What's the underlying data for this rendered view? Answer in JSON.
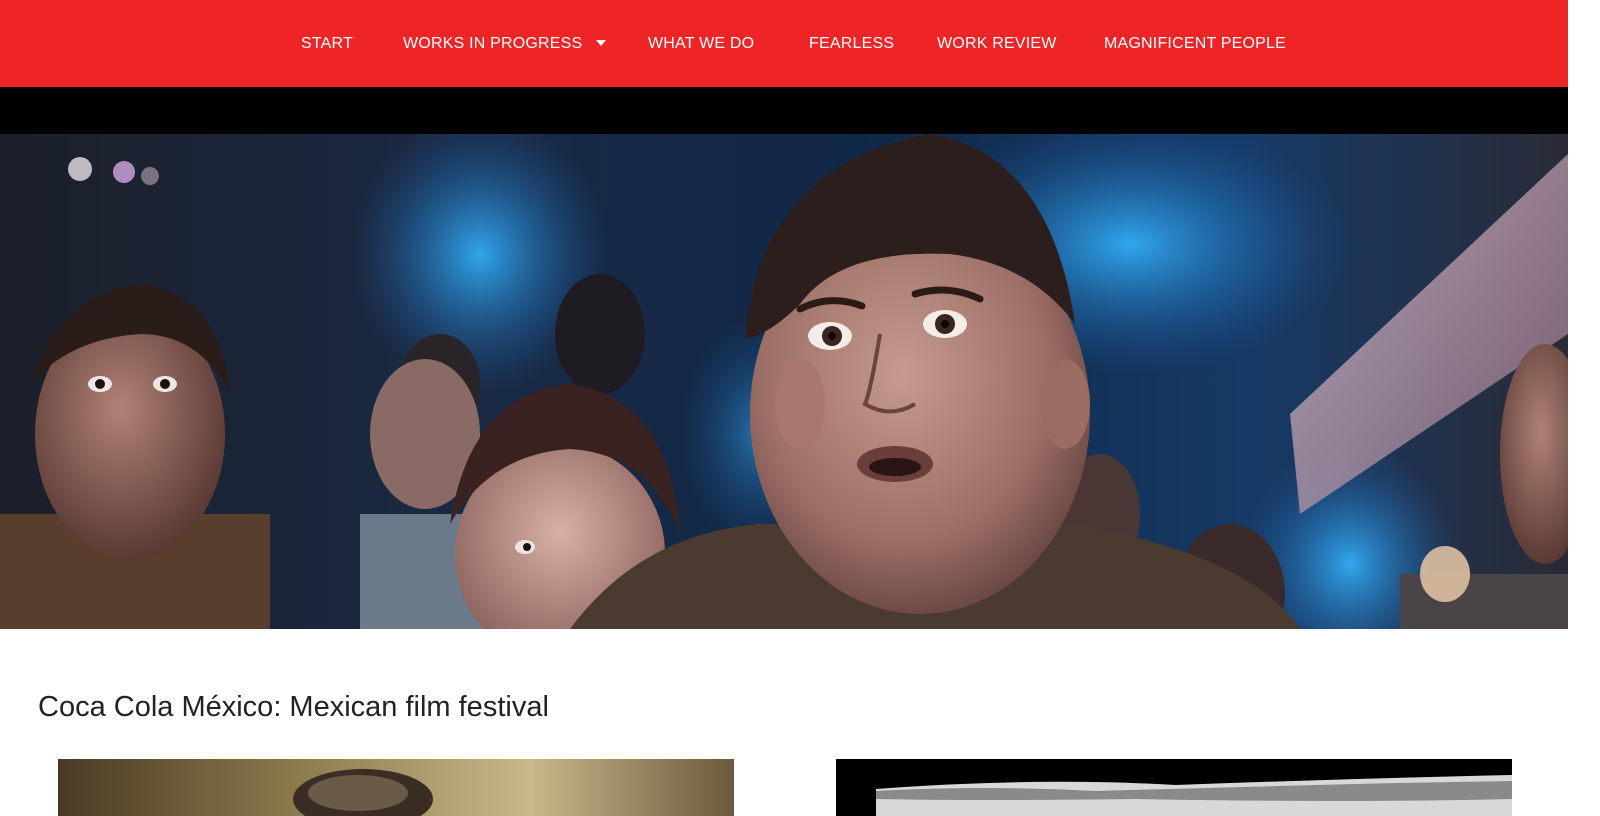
{
  "nav": {
    "items": [
      {
        "label": "START"
      },
      {
        "label": "WORKS IN PROGRESS",
        "has_dropdown": true
      },
      {
        "label": "WHAT WE DO"
      },
      {
        "label": "FEARLESS"
      },
      {
        "label": "WORK REVIEW"
      },
      {
        "label": "MAGNIFICENT PEOPLE"
      }
    ],
    "background_color": "#ee2426",
    "text_color": "#ffffff"
  },
  "hero": {
    "image_description": "film still"
  },
  "project": {
    "title": "Coca Cola México: Mexican film festival"
  },
  "gallery": {
    "items": [
      {
        "type": "image"
      },
      {
        "type": "image"
      }
    ]
  }
}
